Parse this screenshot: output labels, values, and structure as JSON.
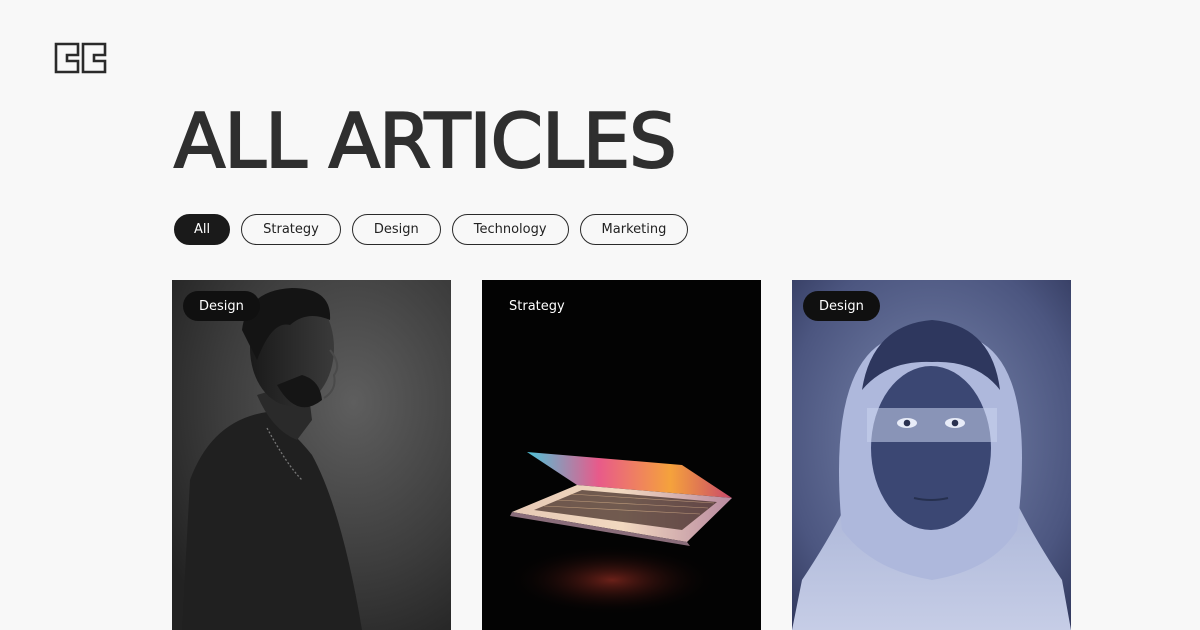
{
  "brand": {
    "logo_icon": "studio-monogram-icon"
  },
  "header": {
    "title": "ALL ARTICLES"
  },
  "filters": {
    "all": "All",
    "strategy": "Strategy",
    "design": "Design",
    "technology": "Technology",
    "marketing": "Marketing",
    "active": "All"
  },
  "cards": [
    {
      "category": "Design",
      "image": "portrait-man-profile-bw"
    },
    {
      "category": "Strategy",
      "image": "laptop-colorful-glow"
    },
    {
      "category": "Design",
      "image": "portrait-man-hoodie-blue"
    }
  ],
  "colors": {
    "background": "#f8f8f8",
    "text": "#2a2a2a",
    "chip_active": "#1a1a1a",
    "tag_bg": "#101010"
  }
}
